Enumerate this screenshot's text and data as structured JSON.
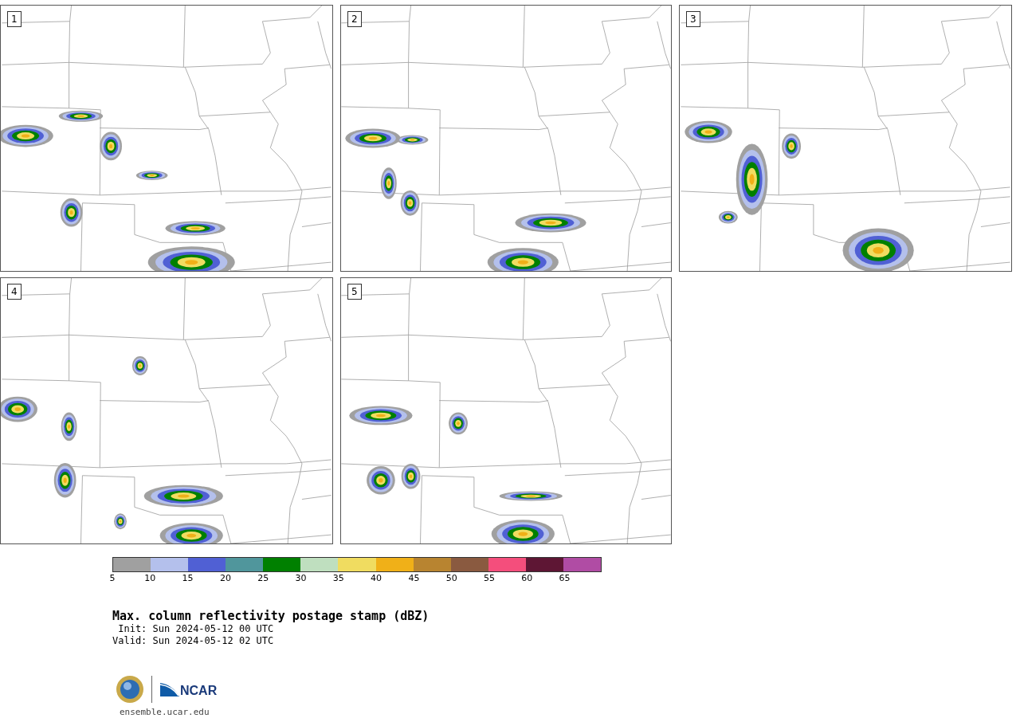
{
  "panels": [
    {
      "number": "1"
    },
    {
      "number": "2"
    },
    {
      "number": "3"
    },
    {
      "number": "4"
    },
    {
      "number": "5"
    }
  ],
  "colorbar": {
    "bins": [
      {
        "color": "#a0a0a0"
      },
      {
        "color": "#b4c0ec"
      },
      {
        "color": "#5060d4"
      },
      {
        "color": "#50969c"
      },
      {
        "color": "#008000"
      },
      {
        "color": "#bfdfbf"
      },
      {
        "color": "#f0dc60"
      },
      {
        "color": "#f0b018"
      },
      {
        "color": "#b88430"
      },
      {
        "color": "#8a5a40"
      },
      {
        "color": "#f44e7c"
      },
      {
        "color": "#5e1634"
      },
      {
        "color": "#b04ca4"
      }
    ],
    "ticks": [
      "5",
      "10",
      "15",
      "20",
      "25",
      "30",
      "35",
      "40",
      "45",
      "50",
      "55",
      "60",
      "65"
    ]
  },
  "title": "Max. column reflectivity postage stamp (dBZ)",
  "init": " Init: Sun 2024-05-12 00 UTC",
  "valid": "Valid: Sun 2024-05-12 02 UTC",
  "logo": {
    "text": "NCAR"
  },
  "url": "ensemble.ucar.edu"
}
